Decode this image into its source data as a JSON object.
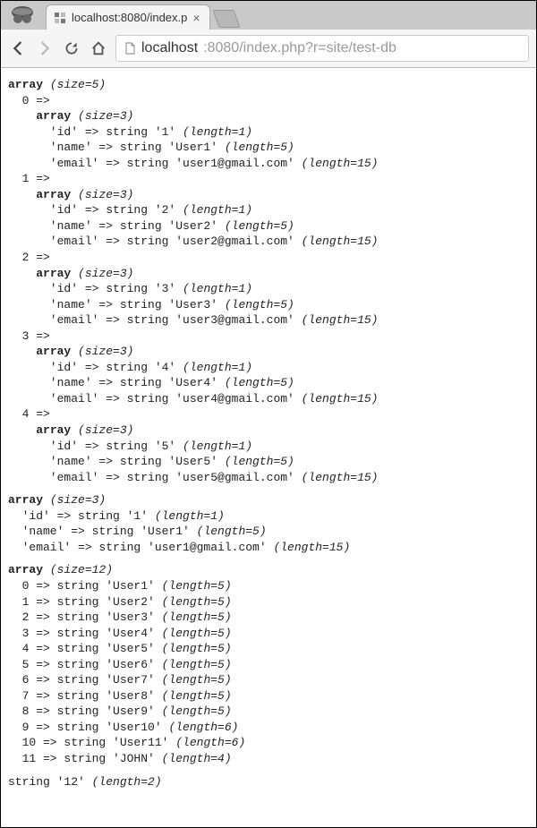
{
  "browser": {
    "tab_title": "localhost:8080/index.p",
    "url_host": "localhost",
    "url_rest": ":8080/index.php?r=site/test-db"
  },
  "dump": {
    "array1": {
      "size": 5,
      "items": [
        {
          "idx": 0,
          "size": 3,
          "id": "1",
          "name": "User1",
          "email": "user1@gmail.com",
          "id_len": 1,
          "name_len": 5,
          "email_len": 15
        },
        {
          "idx": 1,
          "size": 3,
          "id": "2",
          "name": "User2",
          "email": "user2@gmail.com",
          "id_len": 1,
          "name_len": 5,
          "email_len": 15
        },
        {
          "idx": 2,
          "size": 3,
          "id": "3",
          "name": "User3",
          "email": "user3@gmail.com",
          "id_len": 1,
          "name_len": 5,
          "email_len": 15
        },
        {
          "idx": 3,
          "size": 3,
          "id": "4",
          "name": "User4",
          "email": "user4@gmail.com",
          "id_len": 1,
          "name_len": 5,
          "email_len": 15
        },
        {
          "idx": 4,
          "size": 3,
          "id": "5",
          "name": "User5",
          "email": "user5@gmail.com",
          "id_len": 1,
          "name_len": 5,
          "email_len": 15
        }
      ]
    },
    "array2": {
      "size": 3,
      "id": "1",
      "id_len": 1,
      "name": "User1",
      "name_len": 5,
      "email": "user1@gmail.com",
      "email_len": 15
    },
    "array3": {
      "size": 12,
      "items": [
        {
          "idx": 0,
          "val": "User1",
          "len": 5
        },
        {
          "idx": 1,
          "val": "User2",
          "len": 5
        },
        {
          "idx": 2,
          "val": "User3",
          "len": 5
        },
        {
          "idx": 3,
          "val": "User4",
          "len": 5
        },
        {
          "idx": 4,
          "val": "User5",
          "len": 5
        },
        {
          "idx": 5,
          "val": "User6",
          "len": 5
        },
        {
          "idx": 6,
          "val": "User7",
          "len": 5
        },
        {
          "idx": 7,
          "val": "User8",
          "len": 5
        },
        {
          "idx": 8,
          "val": "User9",
          "len": 5
        },
        {
          "idx": 9,
          "val": "User10",
          "len": 6
        },
        {
          "idx": 10,
          "val": "User11",
          "len": 6
        },
        {
          "idx": 11,
          "val": "JOHN",
          "len": 4
        }
      ]
    },
    "final_string": {
      "val": "12",
      "len": 2
    }
  }
}
